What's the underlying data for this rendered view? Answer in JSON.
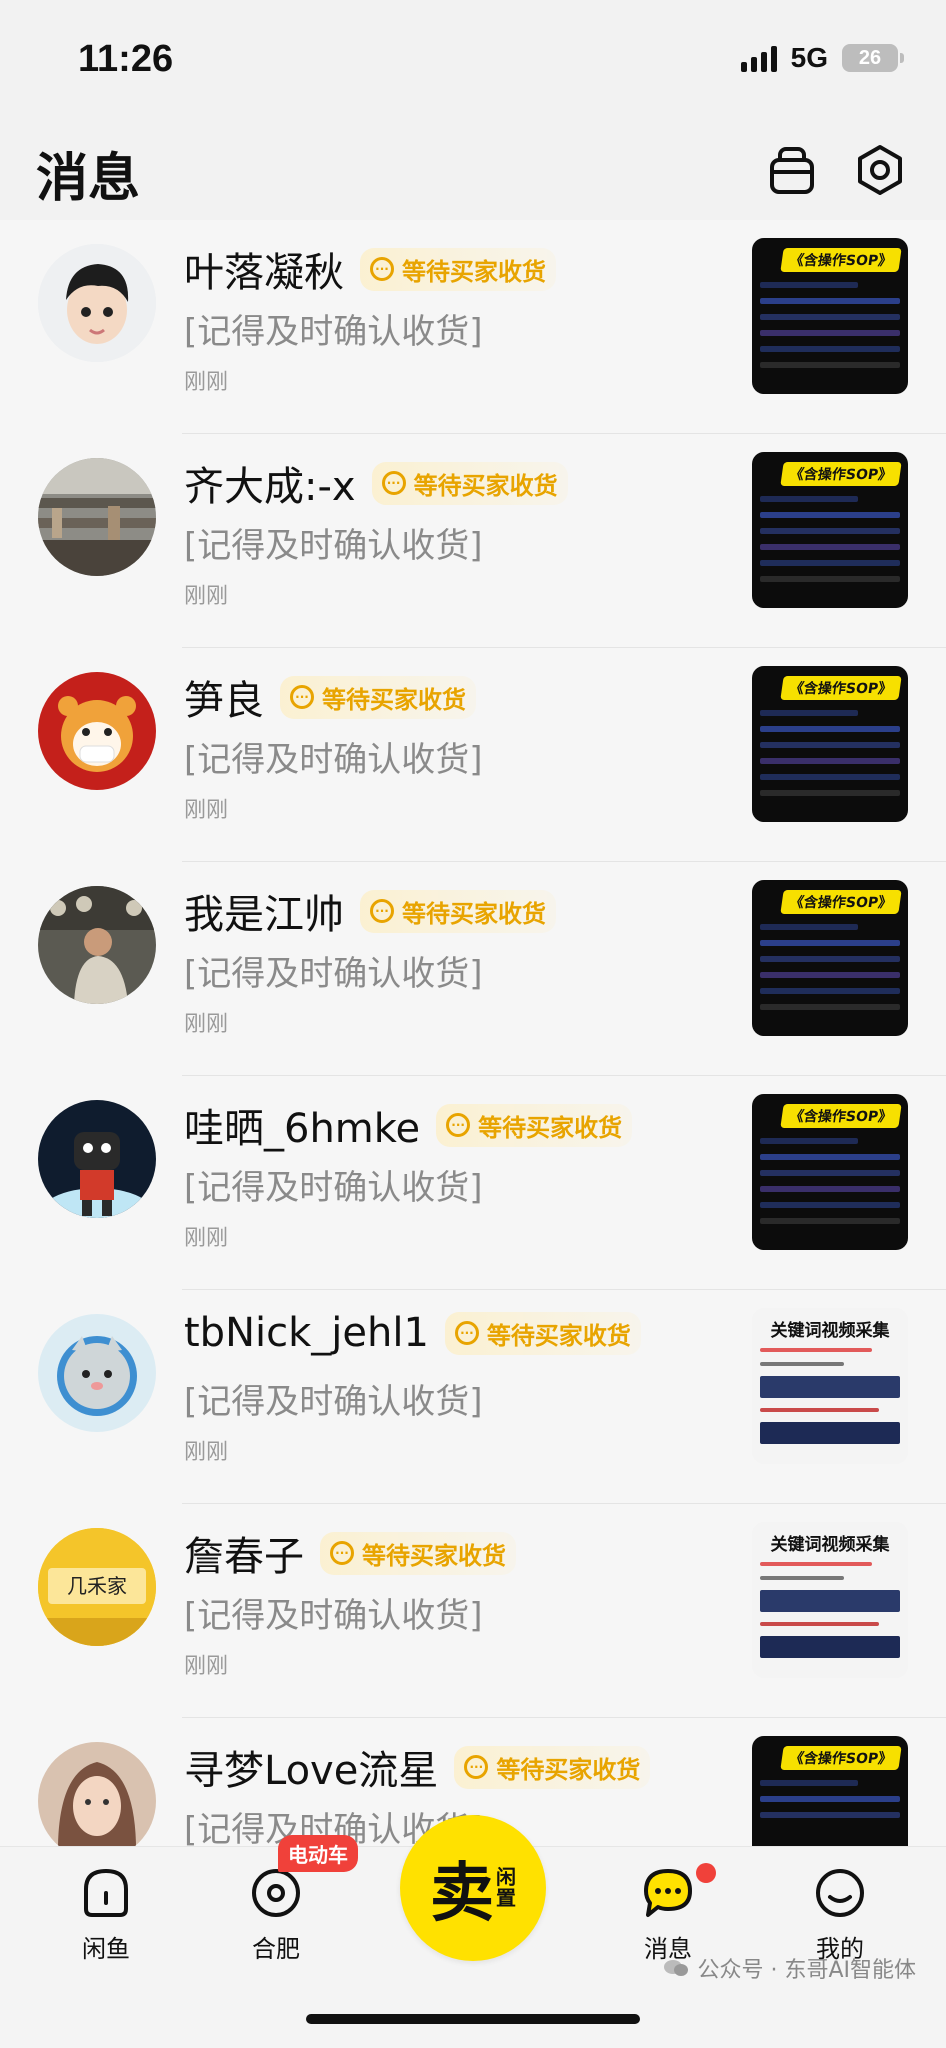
{
  "status_bar": {
    "time": "11:26",
    "network": "5G",
    "battery": "26"
  },
  "header": {
    "title": "消息",
    "bag_icon": "shopping-bag-icon",
    "settings_icon": "settings-icon"
  },
  "messages": [
    {
      "name": "叶落凝秋",
      "tag": "等待买家收货",
      "preview": "[记得及时确认收货]",
      "time": "刚刚",
      "thumb_title": "《含操作SOP》"
    },
    {
      "name": "齐大成:-x",
      "tag": "等待买家收货",
      "preview": "[记得及时确认收货]",
      "time": "刚刚",
      "thumb_title": "《含操作SOP》"
    },
    {
      "name": "笋良",
      "tag": "等待买家收货",
      "preview": "[记得及时确认收货]",
      "time": "刚刚",
      "thumb_title": "《含操作SOP》"
    },
    {
      "name": "我是江帅",
      "tag": "等待买家收货",
      "preview": "[记得及时确认收货]",
      "time": "刚刚",
      "thumb_title": "《含操作SOP》"
    },
    {
      "name": "哇晒_6hmke",
      "tag": "等待买家收货",
      "preview": "[记得及时确认收货]",
      "time": "刚刚",
      "thumb_title": "《含操作SOP》"
    },
    {
      "name": "tbNick_jehl1",
      "tag": "等待买家收货",
      "preview": "[记得及时确认收货]",
      "time": "刚刚",
      "thumb_title": "关键词视频采集"
    },
    {
      "name": "詹春子",
      "tag": "等待买家收货",
      "preview": "[记得及时确认收货]",
      "time": "刚刚",
      "thumb_title": "关键词视频采集",
      "avatar_text": "几禾家"
    },
    {
      "name": "寻梦Love流星",
      "tag": "等待买家收货",
      "preview": "[记得及时确认收货]",
      "time": "",
      "thumb_title": "《含操作SOP》"
    }
  ],
  "tab_bar": {
    "home": "闲鱼",
    "city": "合肥",
    "city_badge": "电动车",
    "sell_main": "卖",
    "sell_sub_1": "闲",
    "sell_sub_2": "置",
    "messages": "消息",
    "profile": "我的"
  },
  "watermark": "公众号 · 东哥AI智能体",
  "colors": {
    "accent": "#ffe100",
    "tag": "#e8a400",
    "badge": "#f0413a"
  }
}
